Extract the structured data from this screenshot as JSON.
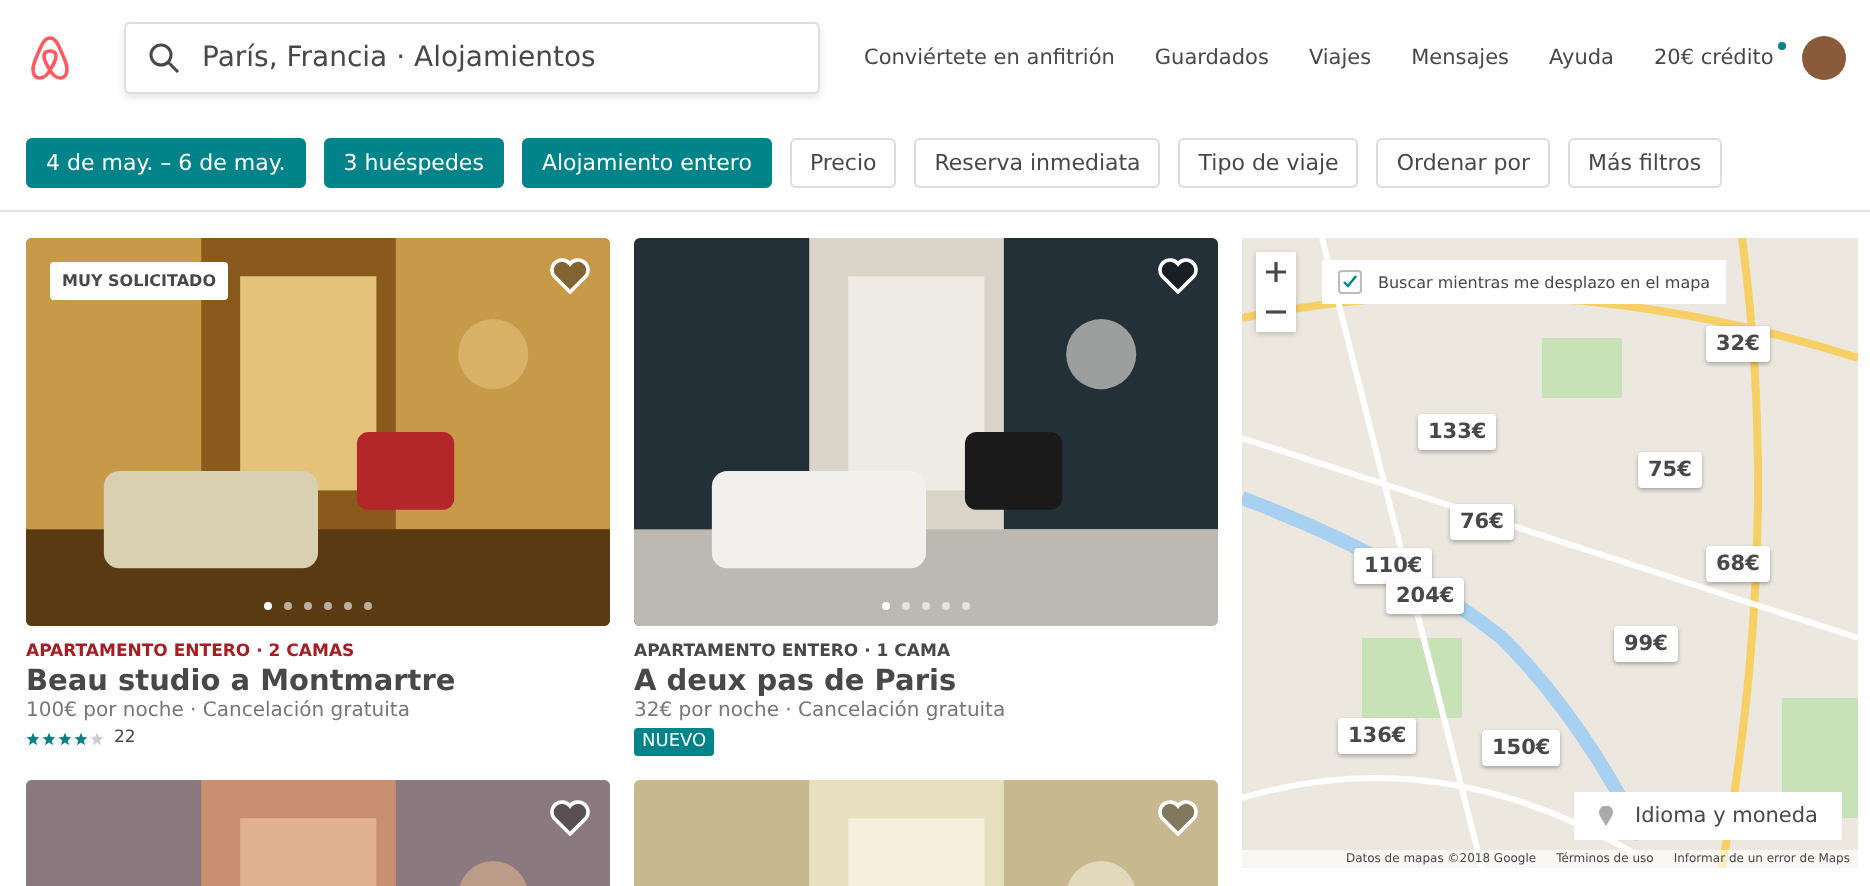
{
  "header": {
    "search": {
      "value": "París, Francia · Alojamientos"
    },
    "nav": [
      {
        "label": "Conviértete en anfitrión"
      },
      {
        "label": "Guardados"
      },
      {
        "label": "Viajes"
      },
      {
        "label": "Mensajes"
      },
      {
        "label": "Ayuda"
      },
      {
        "label": "20€ crédito",
        "notification": true
      }
    ]
  },
  "filters": [
    {
      "label": "4 de may. – 6 de may.",
      "selected": true
    },
    {
      "label": "3 huéspedes",
      "selected": true
    },
    {
      "label": "Alojamiento entero",
      "selected": true
    },
    {
      "label": "Precio",
      "selected": false
    },
    {
      "label": "Reserva inmediata",
      "selected": false
    },
    {
      "label": "Tipo de viaje",
      "selected": false
    },
    {
      "label": "Ordenar por",
      "selected": false
    },
    {
      "label": "Más filtros",
      "selected": false
    }
  ],
  "listings": [
    {
      "kind": "listing",
      "badge": "MUY SOLICITADO",
      "type": "APARTAMENTO ENTERO · 2 CAMAS",
      "type_highlighted": true,
      "title": "Beau studio a Montmartre",
      "price": "100€",
      "price_text": "por noche · Cancelación gratuita",
      "stars": 4,
      "reviews": "22"
    },
    {
      "kind": "listing",
      "type": "APARTAMENTO ENTERO · 1 CAMA",
      "type_highlighted": false,
      "title": "A deux pas de Paris",
      "price": "32€",
      "price_text": "por noche · Cancelación gratuita",
      "tag": "NUEVO"
    },
    {
      "kind": "picture"
    },
    {
      "kind": "picture"
    }
  ],
  "map": {
    "search_while_moving": {
      "label": "Buscar mientras me desplazo en el mapa",
      "checked": true
    },
    "pins": [
      {
        "price": "32€"
      },
      {
        "price": "133€"
      },
      {
        "price": "75€"
      },
      {
        "price": "76€"
      },
      {
        "price": "110€"
      },
      {
        "price": "204€"
      },
      {
        "price": "68€"
      },
      {
        "price": "99€"
      },
      {
        "price": "136€"
      },
      {
        "price": "150€"
      }
    ],
    "language_button": "Idioma y moneda",
    "attribution": [
      "Datos de mapas ©2018 Google",
      "Términos de uso",
      "Informar de un error de Maps"
    ]
  }
}
